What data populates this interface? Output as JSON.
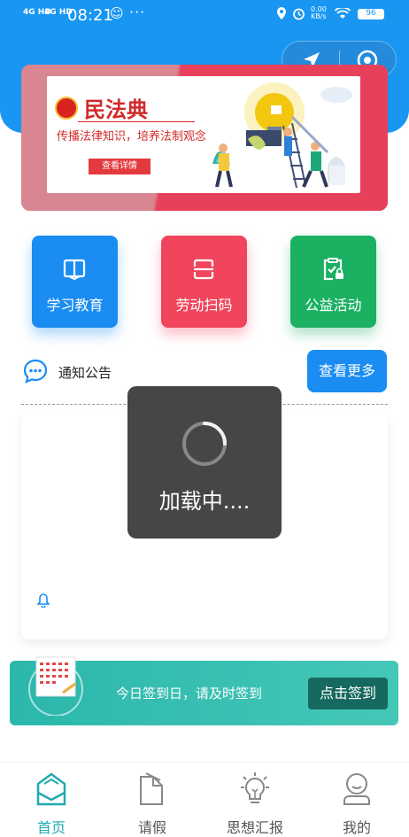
{
  "status_bar": {
    "signal1": "4G HD",
    "signal2": "4G HD",
    "time": "08:21",
    "speed_value": "0.00",
    "speed_unit": "KB/s",
    "battery": "96"
  },
  "banner": {
    "title": "民法典",
    "subtitle": "传播法律知识，培养法制观念",
    "button_label": "查看详情"
  },
  "tiles": [
    {
      "label": "学习教育",
      "icon": "book-icon",
      "color": "#1a8cf2"
    },
    {
      "label": "劳动扫码",
      "icon": "scan-icon",
      "color": "#f0455c"
    },
    {
      "label": "公益活动",
      "icon": "clipboard-icon",
      "color": "#1bb062"
    }
  ],
  "notice": {
    "title": "通知公告",
    "more_label": "查看更多"
  },
  "loading": {
    "text": "加载中...."
  },
  "sign_in": {
    "message": "今日签到日，请及时签到",
    "button_label": "点击签到"
  },
  "tabbar": {
    "items": [
      {
        "label": "首页",
        "icon": "home-icon",
        "active": true
      },
      {
        "label": "请假",
        "icon": "leave-doc-icon",
        "active": false
      },
      {
        "label": "思想汇报",
        "icon": "lightbulb-icon",
        "active": false
      },
      {
        "label": "我的",
        "icon": "user-icon",
        "active": false
      }
    ]
  },
  "colors": {
    "primary": "#1896f2",
    "accent_teal": "#20aab0",
    "banner_red": "#e7405a"
  }
}
